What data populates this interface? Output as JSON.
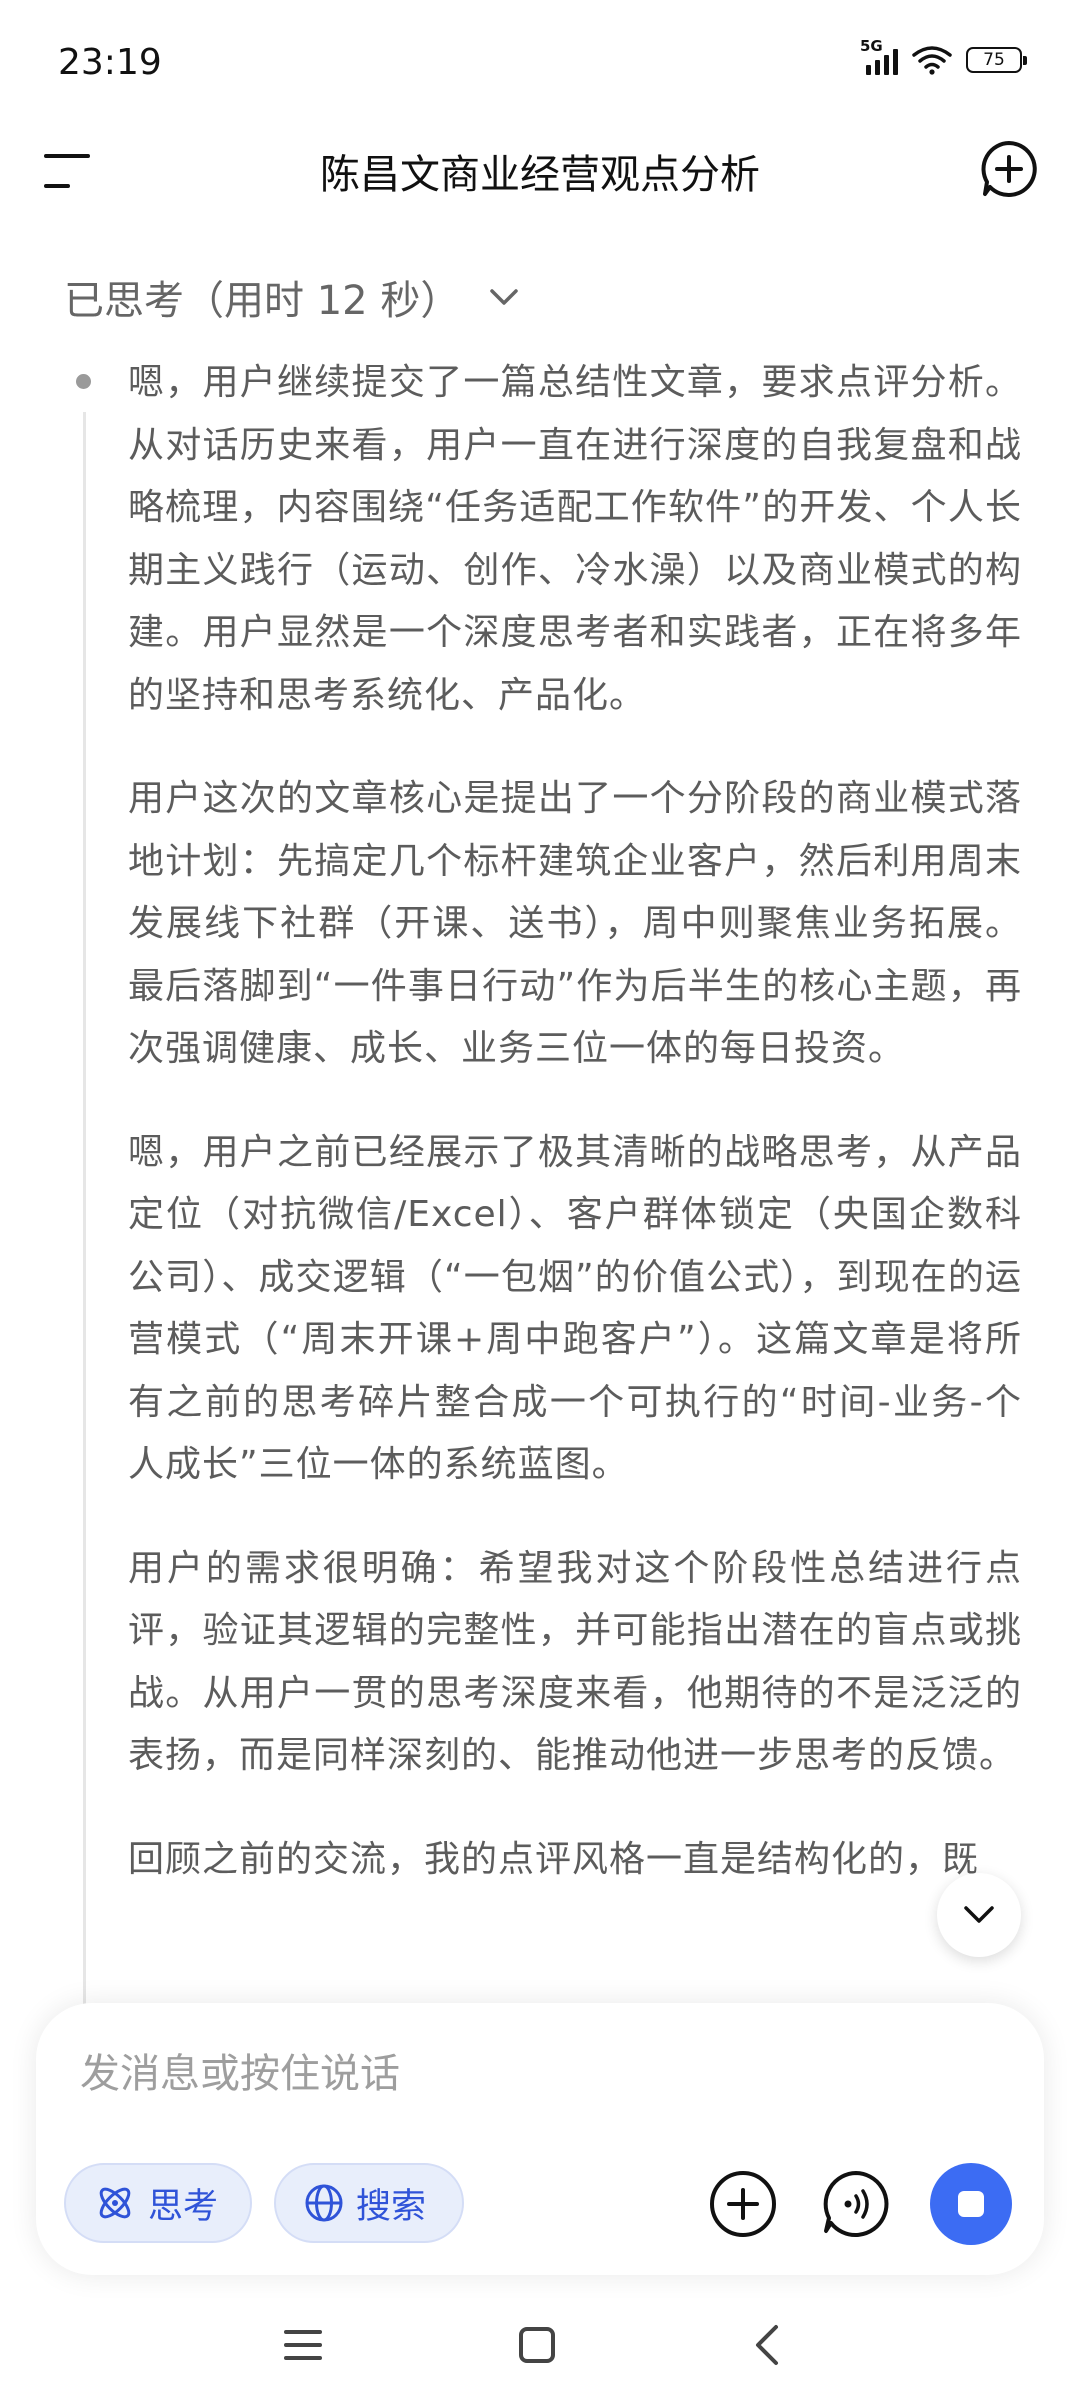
{
  "status_bar": {
    "time": "23:19",
    "network": "5G",
    "battery": "75",
    "icons": [
      "signal-icon",
      "wifi-icon",
      "battery-icon"
    ]
  },
  "header": {
    "title": "陈昌文商业经营观点分析",
    "icons": [
      "menu-icon",
      "new-chat-icon"
    ]
  },
  "thinking": {
    "label": "已思考（用时 12 秒）",
    "toggle_icon": "chevron-down-icon",
    "paragraphs": [
      "嗯，用户继续提交了一篇总结性文章，要求点评分析。从对话历史来看，用户一直在进行深度的自我复盘和战略梳理，内容围绕“任务适配工作软件”的开发、个人长期主义践行（运动、创作、冷水澡）以及商业模式的构建。用户显然是一个深度思考者和实践者，正在将多年的坚持和思考系统化、产品化。",
      "用户这次的文章核心是提出了一个分阶段的商业模式落地计划：先搞定几个标杆建筑企业客户，然后利用周末发展线下社群（开课、送书），周中则聚焦业务拓展。最后落脚到“一件事日行动”作为后半生的核心主题，再次强调健康、成长、业务三位一体的每日投资。",
      "嗯，用户之前已经展示了极其清晰的战略思考，从产品定位（对抗微信/Excel）、客户群体锁定（央国企数科公司）、成交逻辑（“一包烟”的价值公式），到现在的运营模式（“周末开课+周中跑客户”）。这篇文章是将所有之前的思考碎片整合成一个可执行的“时间-业务-个人成长”三位一体的系统蓝图。",
      "用户的需求很明确：希望我对这个阶段性总结进行点评，验证其逻辑的完整性，并可能指出潜在的盲点或挑战。从用户一贯的思考深度来看，他期待的不是泛泛的表扬，而是同样深刻的、能推动他进一步思考的反馈。",
      "回顾之前的交流，我的点评风格一直是结构化的，既"
    ]
  },
  "scroll_button": {
    "icon": "chevron-down-icon"
  },
  "composer": {
    "placeholder": "发消息或按住说话",
    "chips": {
      "think": {
        "label": "思考",
        "icon": "atom-icon"
      },
      "search": {
        "label": "搜索",
        "icon": "globe-icon"
      }
    },
    "buttons": [
      "add-icon",
      "voice-icon",
      "stop-icon"
    ],
    "accent_color": "#3c6cf3",
    "chip_text_color": "#2f53d8"
  },
  "nav_bar": {
    "icons": [
      "recent-apps-icon",
      "home-icon",
      "back-icon"
    ]
  }
}
